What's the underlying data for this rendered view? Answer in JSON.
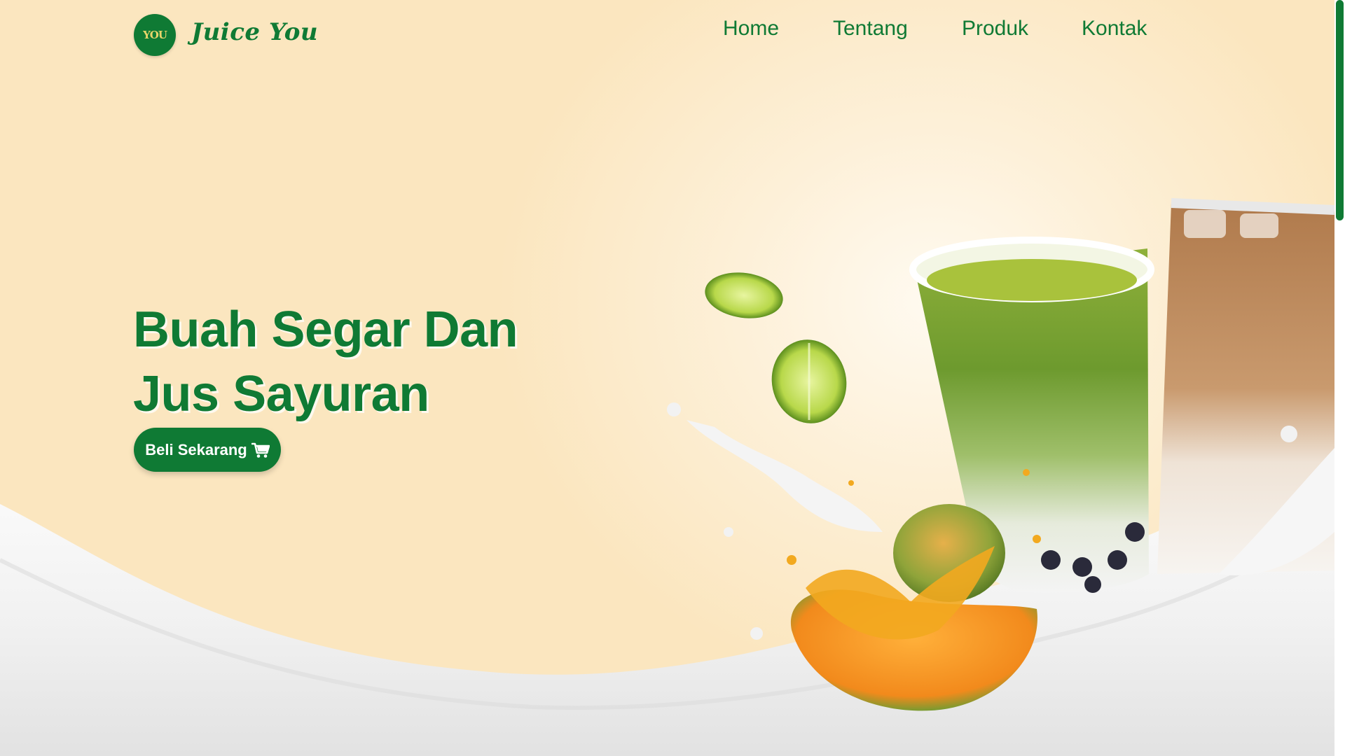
{
  "brand": {
    "logo_text": "YOU",
    "name": "Juice You",
    "color": "#0f7a34"
  },
  "nav": {
    "items": [
      {
        "label": "Home"
      },
      {
        "label": "Tentang"
      },
      {
        "label": "Produk"
      },
      {
        "label": "Kontak"
      }
    ]
  },
  "hero": {
    "title_line1": "Buah Segar Dan",
    "title_line2": "Jus Sayuran",
    "cta_label": "Beli Sekarang",
    "cta_icon": "cart-icon"
  },
  "colors": {
    "accent": "#0f7a34",
    "background": "#fbe6bf",
    "milk": "#ffffff"
  }
}
